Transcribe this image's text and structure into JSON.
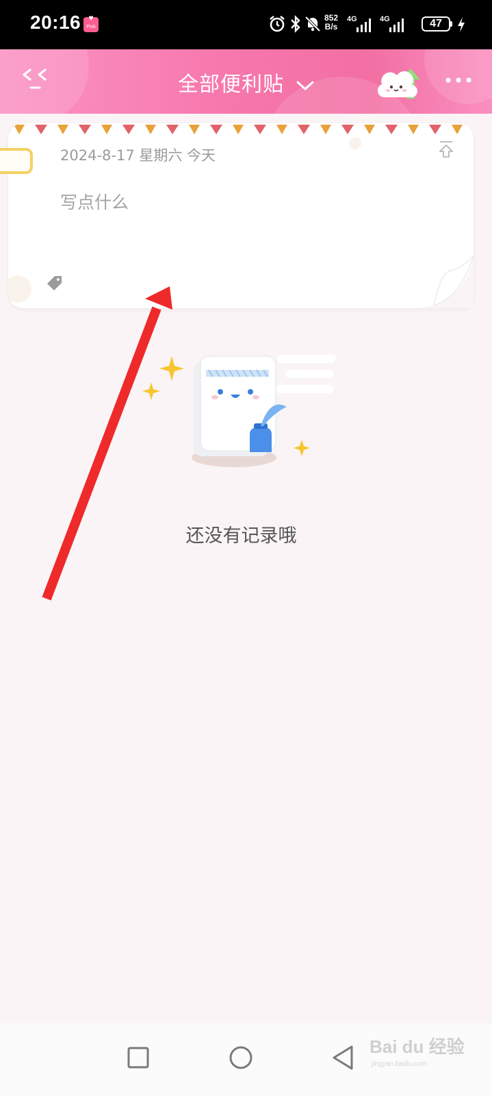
{
  "status_bar": {
    "time": "20:16",
    "app_badge": "Pink",
    "net_speed_top": "852",
    "net_speed_bottom": "B/s",
    "signal1": "4G",
    "signal2": "4G",
    "battery": "47"
  },
  "header": {
    "title": "全部便利贴",
    "back_icon": "back-chevrons-icon",
    "cloud_icon": "cloud-sync-icon",
    "more_icon": "more-dots-icon"
  },
  "note": {
    "date": "2024-8-17 星期六 今天",
    "placeholder": "写点什么"
  },
  "empty_state": {
    "text": "还没有记录哦"
  },
  "watermark": {
    "brand": "Bai du 经验",
    "url": "jingyan.baidu.com"
  },
  "colors": {
    "header_pink": "#f778ad",
    "arrow_red": "#ee2a2a",
    "tab_yellow": "#f5d062"
  }
}
